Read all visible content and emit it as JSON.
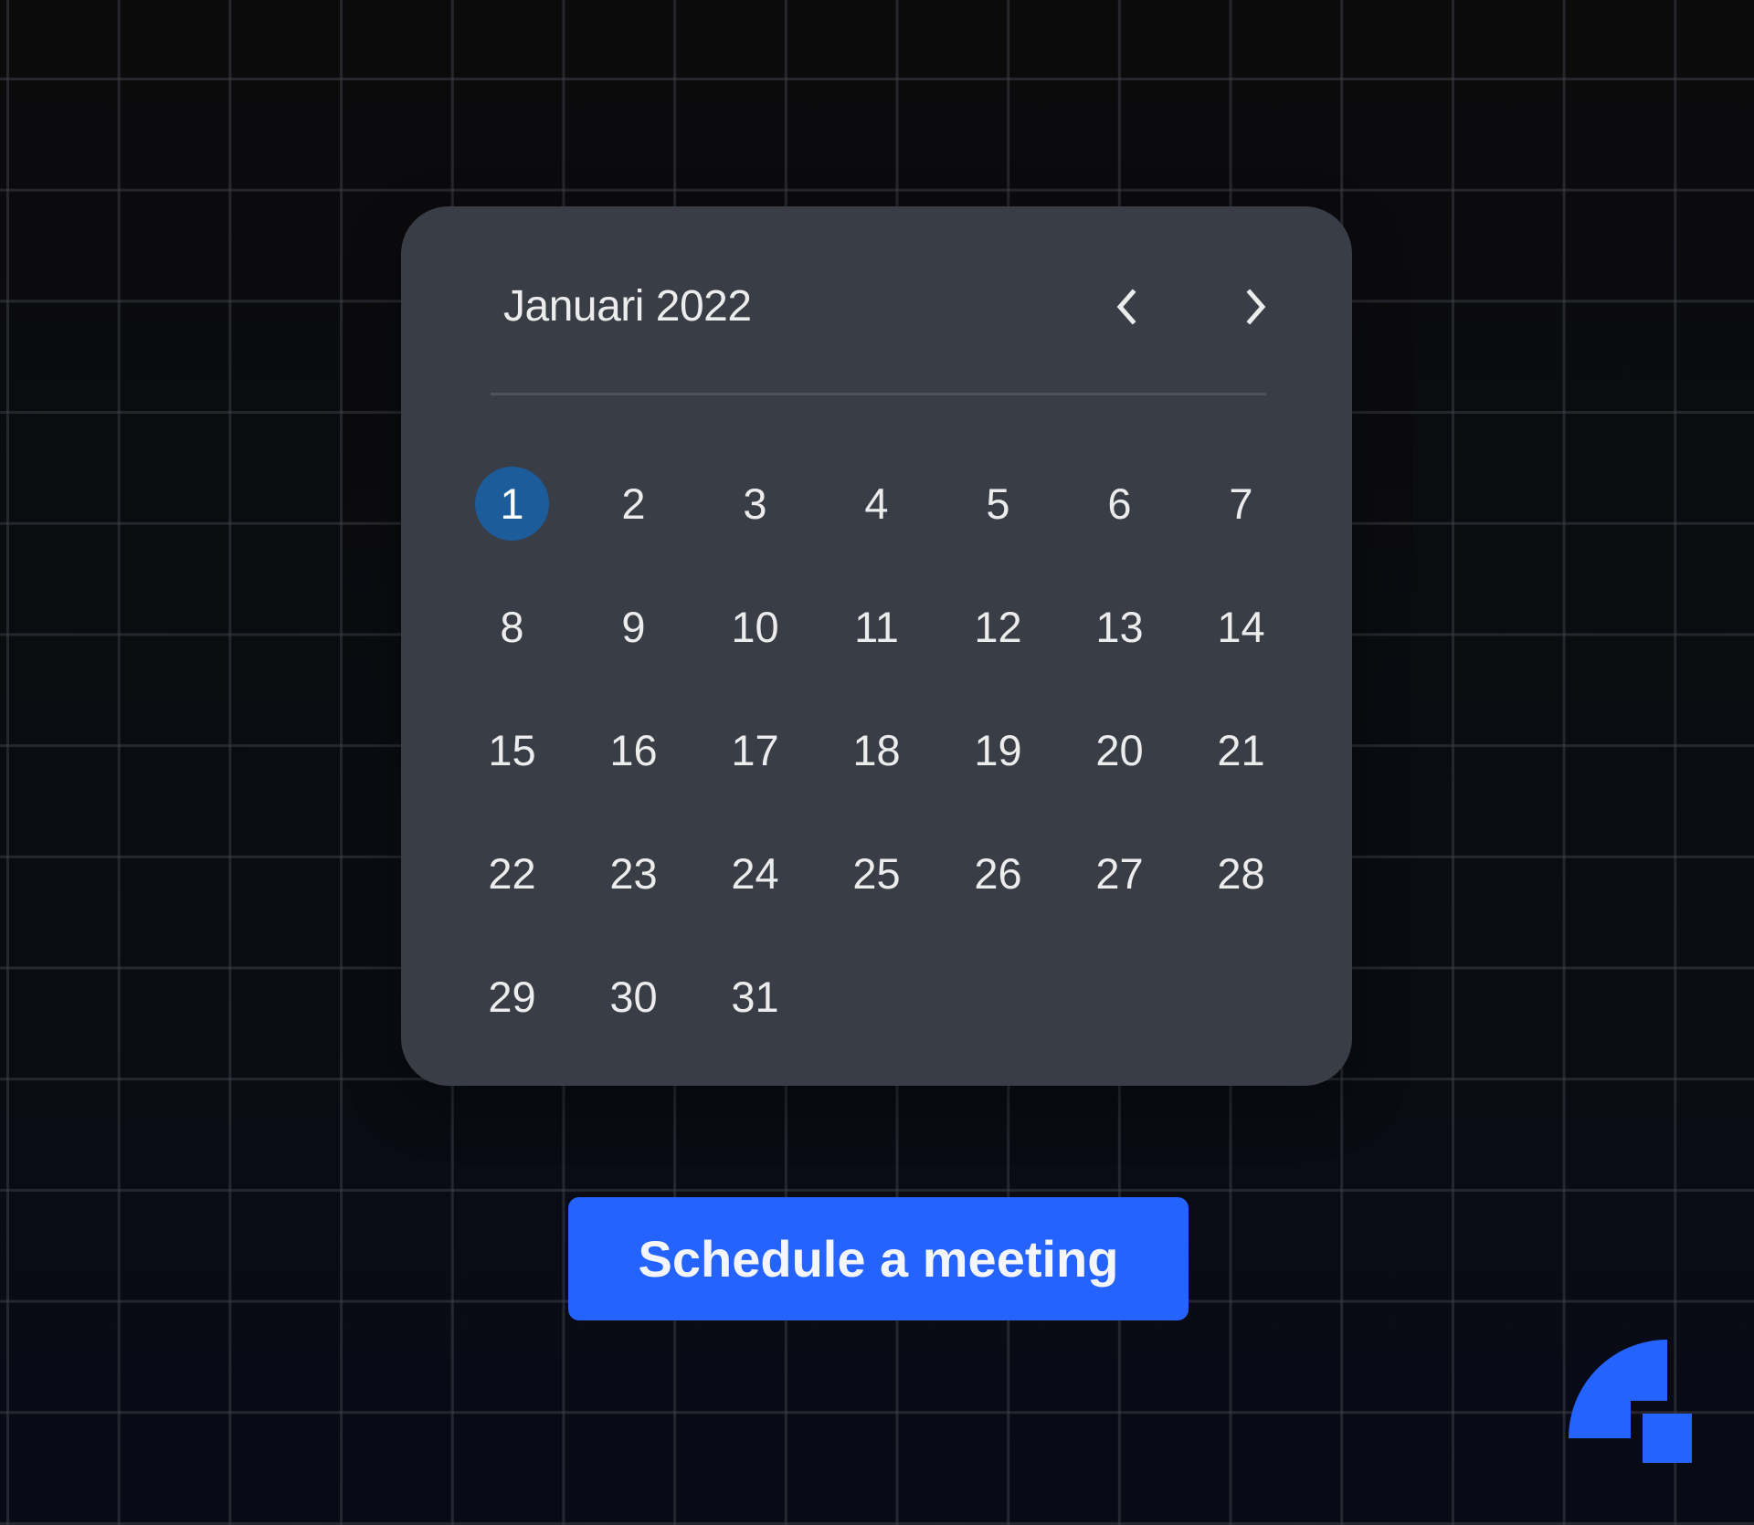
{
  "calendar": {
    "month_title": "Januari 2022",
    "prev_icon": "chevron-left-icon",
    "next_icon": "chevron-right-icon",
    "selected_day": "1",
    "days": [
      "1",
      "2",
      "3",
      "4",
      "5",
      "6",
      "7",
      "8",
      "9",
      "10",
      "11",
      "12",
      "13",
      "14",
      "15",
      "16",
      "17",
      "18",
      "19",
      "20",
      "21",
      "22",
      "23",
      "24",
      "25",
      "26",
      "27",
      "28",
      "29",
      "30",
      "31"
    ]
  },
  "cta": {
    "label": "Schedule a meeting"
  },
  "logo": {
    "icon": "brand-logo-icon"
  },
  "colors": {
    "accent": "#2563fe",
    "selected_day": "#1c5c9b",
    "card": "#393d46",
    "text": "#ececec"
  }
}
